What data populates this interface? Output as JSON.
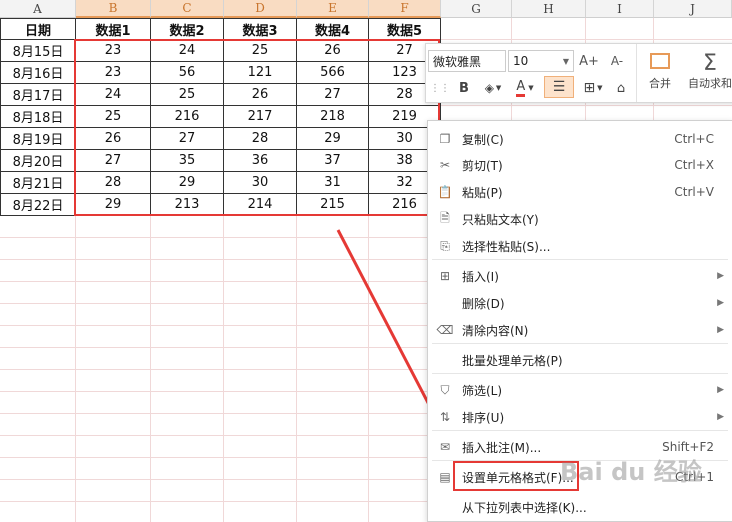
{
  "columns": [
    "A",
    "B",
    "C",
    "D",
    "E",
    "F",
    "G",
    "H",
    "I",
    "J"
  ],
  "selected_columns": [
    "B",
    "C",
    "D",
    "E",
    "F"
  ],
  "table": {
    "headers": [
      "日期",
      "数据1",
      "数据2",
      "数据3",
      "数据4",
      "数据5"
    ],
    "rows": [
      [
        "8月15日",
        "23",
        "24",
        "25",
        "26",
        "27"
      ],
      [
        "8月16日",
        "23",
        "56",
        "121",
        "566",
        "123"
      ],
      [
        "8月17日",
        "24",
        "25",
        "26",
        "27",
        "28"
      ],
      [
        "8月18日",
        "25",
        "216",
        "217",
        "218",
        "219"
      ],
      [
        "8月19日",
        "26",
        "27",
        "28",
        "29",
        "30"
      ],
      [
        "8月20日",
        "27",
        "35",
        "36",
        "37",
        "38"
      ],
      [
        "8月21日",
        "28",
        "29",
        "30",
        "31",
        "32"
      ],
      [
        "8月22日",
        "29",
        "213",
        "214",
        "215",
        "216"
      ]
    ]
  },
  "toolbar": {
    "font_name": "微软雅黑",
    "font_size": "10",
    "grow_font": "A+",
    "shrink_font": "A-",
    "bold": "B",
    "font_color": "A",
    "merge_label": "合并",
    "autosum_label": "自动求和"
  },
  "context_menu": [
    {
      "icon": "copy-icon",
      "label": "复制(C)",
      "shortcut": "Ctrl+C",
      "submenu": false
    },
    {
      "icon": "cut-icon",
      "label": "剪切(T)",
      "shortcut": "Ctrl+X",
      "submenu": false
    },
    {
      "icon": "paste-icon",
      "label": "粘贴(P)",
      "shortcut": "Ctrl+V",
      "submenu": false
    },
    {
      "icon": "paste-text-icon",
      "label": "只粘贴文本(Y)",
      "shortcut": "",
      "submenu": false
    },
    {
      "icon": "paste-special-icon",
      "label": "选择性粘贴(S)...",
      "shortcut": "",
      "submenu": false
    },
    {
      "icon": "insert-icon",
      "label": "插入(I)",
      "shortcut": "",
      "submenu": true
    },
    {
      "icon": "",
      "label": "删除(D)",
      "shortcut": "",
      "submenu": true
    },
    {
      "icon": "eraser-icon",
      "label": "清除内容(N)",
      "shortcut": "",
      "submenu": true
    },
    {
      "icon": "",
      "label": "批量处理单元格(P)",
      "shortcut": "",
      "submenu": false
    },
    {
      "icon": "filter-icon",
      "label": "筛选(L)",
      "shortcut": "",
      "submenu": true
    },
    {
      "icon": "sort-icon",
      "label": "排序(U)",
      "shortcut": "",
      "submenu": true
    },
    {
      "icon": "comment-icon",
      "label": "插入批注(M)...",
      "shortcut": "Shift+F2",
      "submenu": false
    },
    {
      "icon": "format-cells-icon",
      "label": "设置单元格格式(F)...",
      "shortcut": "Ctrl+1",
      "submenu": false
    },
    {
      "icon": "",
      "label": "从下拉列表中选择(K)...",
      "shortcut": "",
      "submenu": false
    }
  ],
  "watermark": "Bai du 经验",
  "colors": {
    "selection_border": "#e53935",
    "column_highlight": "#f9dcc2",
    "arrow": "#e53935"
  }
}
